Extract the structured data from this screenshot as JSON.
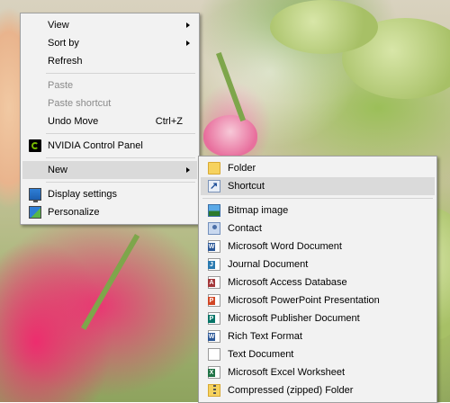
{
  "context_menu": {
    "items": [
      {
        "label": "View",
        "submenu": true
      },
      {
        "label": "Sort by",
        "submenu": true
      },
      {
        "label": "Refresh"
      },
      {
        "label": "Paste",
        "disabled": true
      },
      {
        "label": "Paste shortcut",
        "disabled": true
      },
      {
        "label": "Undo Move",
        "shortcut": "Ctrl+Z"
      },
      {
        "label": "NVIDIA Control Panel",
        "icon": "nvidia-icon"
      },
      {
        "label": "New",
        "submenu": true,
        "highlighted": true
      },
      {
        "label": "Display settings",
        "icon": "display-settings-icon"
      },
      {
        "label": "Personalize",
        "icon": "personalize-icon"
      }
    ]
  },
  "new_submenu": {
    "items": [
      {
        "label": "Folder",
        "icon": "folder-icon"
      },
      {
        "label": "Shortcut",
        "icon": "shortcut-icon",
        "highlighted": true
      },
      {
        "label": "Bitmap image",
        "icon": "bitmap-image-icon"
      },
      {
        "label": "Contact",
        "icon": "contact-icon"
      },
      {
        "label": "Microsoft Word Document",
        "icon": "word-document-icon"
      },
      {
        "label": "Journal Document",
        "icon": "journal-document-icon"
      },
      {
        "label": "Microsoft Access Database",
        "icon": "access-database-icon"
      },
      {
        "label": "Microsoft PowerPoint Presentation",
        "icon": "powerpoint-icon"
      },
      {
        "label": "Microsoft Publisher Document",
        "icon": "publisher-icon"
      },
      {
        "label": "Rich Text Format",
        "icon": "rich-text-icon"
      },
      {
        "label": "Text Document",
        "icon": "text-document-icon"
      },
      {
        "label": "Microsoft Excel Worksheet",
        "icon": "excel-icon"
      },
      {
        "label": "Compressed (zipped) Folder",
        "icon": "zip-folder-icon"
      }
    ]
  },
  "colors": {
    "menu_background": "#f2f2f2",
    "menu_border": "#a0a0a0",
    "highlight": "#dadada",
    "disabled_text": "#8a8a8a"
  }
}
